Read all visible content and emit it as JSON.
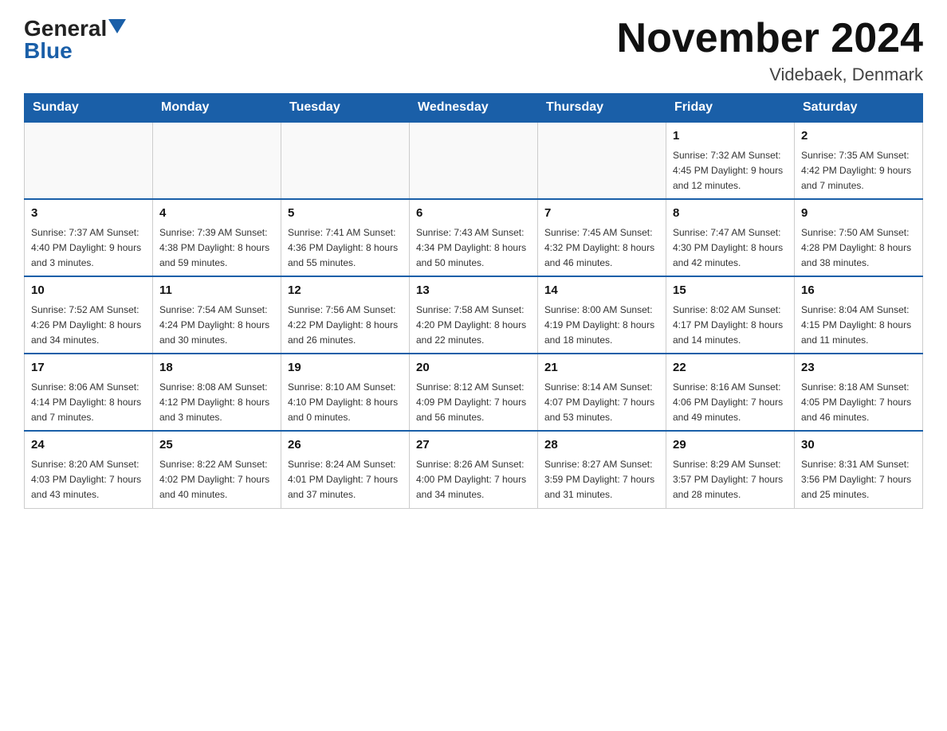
{
  "header": {
    "logo_general": "General",
    "logo_blue": "Blue",
    "title": "November 2024",
    "subtitle": "Videbaek, Denmark"
  },
  "calendar": {
    "days_of_week": [
      "Sunday",
      "Monday",
      "Tuesday",
      "Wednesday",
      "Thursday",
      "Friday",
      "Saturday"
    ],
    "weeks": [
      {
        "days": [
          {
            "date": "",
            "info": ""
          },
          {
            "date": "",
            "info": ""
          },
          {
            "date": "",
            "info": ""
          },
          {
            "date": "",
            "info": ""
          },
          {
            "date": "",
            "info": ""
          },
          {
            "date": "1",
            "info": "Sunrise: 7:32 AM\nSunset: 4:45 PM\nDaylight: 9 hours\nand 12 minutes."
          },
          {
            "date": "2",
            "info": "Sunrise: 7:35 AM\nSunset: 4:42 PM\nDaylight: 9 hours\nand 7 minutes."
          }
        ]
      },
      {
        "days": [
          {
            "date": "3",
            "info": "Sunrise: 7:37 AM\nSunset: 4:40 PM\nDaylight: 9 hours\nand 3 minutes."
          },
          {
            "date": "4",
            "info": "Sunrise: 7:39 AM\nSunset: 4:38 PM\nDaylight: 8 hours\nand 59 minutes."
          },
          {
            "date": "5",
            "info": "Sunrise: 7:41 AM\nSunset: 4:36 PM\nDaylight: 8 hours\nand 55 minutes."
          },
          {
            "date": "6",
            "info": "Sunrise: 7:43 AM\nSunset: 4:34 PM\nDaylight: 8 hours\nand 50 minutes."
          },
          {
            "date": "7",
            "info": "Sunrise: 7:45 AM\nSunset: 4:32 PM\nDaylight: 8 hours\nand 46 minutes."
          },
          {
            "date": "8",
            "info": "Sunrise: 7:47 AM\nSunset: 4:30 PM\nDaylight: 8 hours\nand 42 minutes."
          },
          {
            "date": "9",
            "info": "Sunrise: 7:50 AM\nSunset: 4:28 PM\nDaylight: 8 hours\nand 38 minutes."
          }
        ]
      },
      {
        "days": [
          {
            "date": "10",
            "info": "Sunrise: 7:52 AM\nSunset: 4:26 PM\nDaylight: 8 hours\nand 34 minutes."
          },
          {
            "date": "11",
            "info": "Sunrise: 7:54 AM\nSunset: 4:24 PM\nDaylight: 8 hours\nand 30 minutes."
          },
          {
            "date": "12",
            "info": "Sunrise: 7:56 AM\nSunset: 4:22 PM\nDaylight: 8 hours\nand 26 minutes."
          },
          {
            "date": "13",
            "info": "Sunrise: 7:58 AM\nSunset: 4:20 PM\nDaylight: 8 hours\nand 22 minutes."
          },
          {
            "date": "14",
            "info": "Sunrise: 8:00 AM\nSunset: 4:19 PM\nDaylight: 8 hours\nand 18 minutes."
          },
          {
            "date": "15",
            "info": "Sunrise: 8:02 AM\nSunset: 4:17 PM\nDaylight: 8 hours\nand 14 minutes."
          },
          {
            "date": "16",
            "info": "Sunrise: 8:04 AM\nSunset: 4:15 PM\nDaylight: 8 hours\nand 11 minutes."
          }
        ]
      },
      {
        "days": [
          {
            "date": "17",
            "info": "Sunrise: 8:06 AM\nSunset: 4:14 PM\nDaylight: 8 hours\nand 7 minutes."
          },
          {
            "date": "18",
            "info": "Sunrise: 8:08 AM\nSunset: 4:12 PM\nDaylight: 8 hours\nand 3 minutes."
          },
          {
            "date": "19",
            "info": "Sunrise: 8:10 AM\nSunset: 4:10 PM\nDaylight: 8 hours\nand 0 minutes."
          },
          {
            "date": "20",
            "info": "Sunrise: 8:12 AM\nSunset: 4:09 PM\nDaylight: 7 hours\nand 56 minutes."
          },
          {
            "date": "21",
            "info": "Sunrise: 8:14 AM\nSunset: 4:07 PM\nDaylight: 7 hours\nand 53 minutes."
          },
          {
            "date": "22",
            "info": "Sunrise: 8:16 AM\nSunset: 4:06 PM\nDaylight: 7 hours\nand 49 minutes."
          },
          {
            "date": "23",
            "info": "Sunrise: 8:18 AM\nSunset: 4:05 PM\nDaylight: 7 hours\nand 46 minutes."
          }
        ]
      },
      {
        "days": [
          {
            "date": "24",
            "info": "Sunrise: 8:20 AM\nSunset: 4:03 PM\nDaylight: 7 hours\nand 43 minutes."
          },
          {
            "date": "25",
            "info": "Sunrise: 8:22 AM\nSunset: 4:02 PM\nDaylight: 7 hours\nand 40 minutes."
          },
          {
            "date": "26",
            "info": "Sunrise: 8:24 AM\nSunset: 4:01 PM\nDaylight: 7 hours\nand 37 minutes."
          },
          {
            "date": "27",
            "info": "Sunrise: 8:26 AM\nSunset: 4:00 PM\nDaylight: 7 hours\nand 34 minutes."
          },
          {
            "date": "28",
            "info": "Sunrise: 8:27 AM\nSunset: 3:59 PM\nDaylight: 7 hours\nand 31 minutes."
          },
          {
            "date": "29",
            "info": "Sunrise: 8:29 AM\nSunset: 3:57 PM\nDaylight: 7 hours\nand 28 minutes."
          },
          {
            "date": "30",
            "info": "Sunrise: 8:31 AM\nSunset: 3:56 PM\nDaylight: 7 hours\nand 25 minutes."
          }
        ]
      }
    ]
  }
}
